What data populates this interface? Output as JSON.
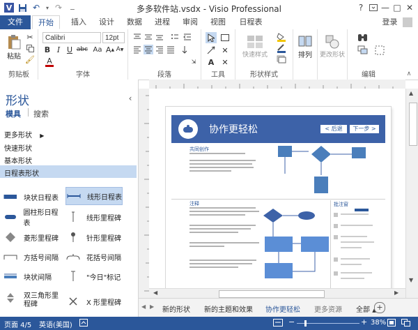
{
  "titlebar": {
    "title": "多多软件站.vsdx - Visio Professional",
    "help": "?",
    "minimize": "—",
    "restore": "□",
    "close": "✕"
  },
  "tabs": {
    "file": "文件",
    "home": "开始",
    "insert": "插入",
    "design": "设计",
    "data": "数据",
    "process": "进程",
    "review": "审阅",
    "view": "视图",
    "schedule": "日程表",
    "login": "登录"
  },
  "ribbon": {
    "paste": "粘贴",
    "clipboard": "剪贴板",
    "font_name": "Calibri",
    "font_size": "12pt",
    "font": "字体",
    "paragraph": "段落",
    "tools": "工具",
    "quick_styles": "快速样式",
    "shape_styles": "形状样式",
    "arrange": "排列",
    "change_shape": "更改形状",
    "edit": "编辑"
  },
  "pane": {
    "title": "形状",
    "tab_stencils": "模具",
    "tab_search": "搜索",
    "more_shapes": "更多形状",
    "quick_shapes": "快速形状",
    "basic_shapes": "基本形状",
    "timeline_shapes": "日程表形状",
    "shapes": [
      "块状日程表",
      "线形日程表",
      "圆柱形日程表",
      "线形里程碑",
      "菱形里程碑",
      "针形里程碑",
      "方括号间隔",
      "花括号间隔",
      "块状间隔",
      "\"今日\"标记",
      "双三角形里程碑",
      "X 形里程碑"
    ]
  },
  "page_content": {
    "banner_title": "协作更轻松",
    "back": "< 后退",
    "next": "下一步 >",
    "section1": "共同创作",
    "section2": "注释",
    "comments_title": "批注窗"
  },
  "pagetabs": {
    "tab1": "新的形状",
    "tab2": "新的主题和效果",
    "tab3": "协作更轻松",
    "tab4": "更多资源",
    "tab5": "全部"
  },
  "status": {
    "page": "页面 4/5",
    "language": "英语(美国)",
    "zoom": "38%"
  },
  "colors": {
    "accent": "#2b579a",
    "banner": "#3d62a8",
    "diagram_blue": "#4a7ebb"
  }
}
